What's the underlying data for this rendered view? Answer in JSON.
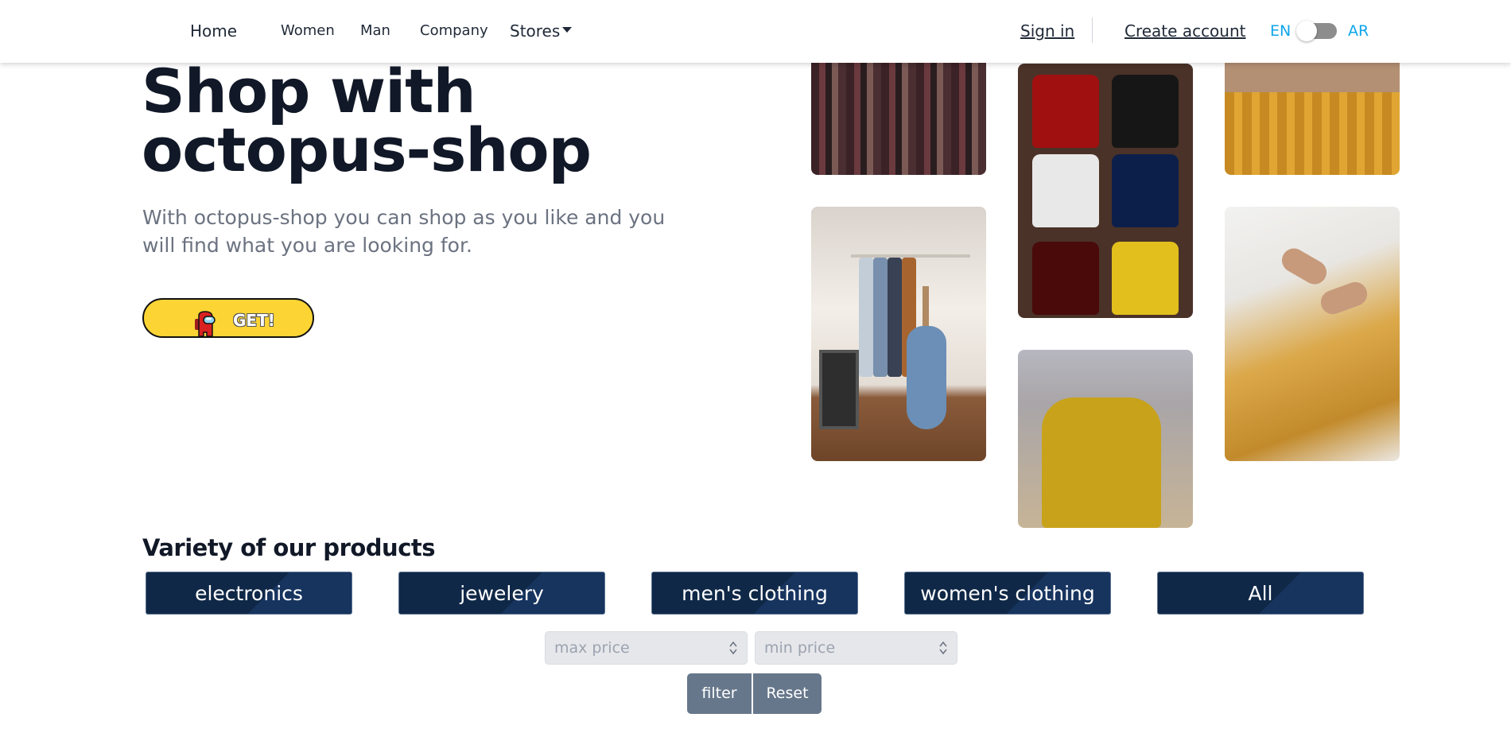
{
  "nav": {
    "home": "Home",
    "women": "Women",
    "man": "Man",
    "company": "Company",
    "stores": "Stores",
    "sign_in": "Sign in",
    "create_account": "Create account",
    "lang_en": "EN",
    "lang_ar": "AR"
  },
  "hero": {
    "title_line1": "Shop with",
    "title_line2": "octopus-shop",
    "subtitle": "With octopus-shop you can shop as you like and you will find what you are looking for.",
    "cta_label": "GET!"
  },
  "products": {
    "title": "Variety of our products",
    "categories": [
      "electronics",
      "jewelery",
      "men's clothing",
      "women's clothing",
      "All"
    ],
    "max_price_placeholder": "max price",
    "min_price_placeholder": "min price",
    "filter_label": "filter",
    "reset_label": "Reset"
  },
  "colors": {
    "category_bg": "#0f2847",
    "cta_bg": "#fcd535",
    "accent": "#0ea5e9",
    "filter_bg": "#67778b"
  }
}
